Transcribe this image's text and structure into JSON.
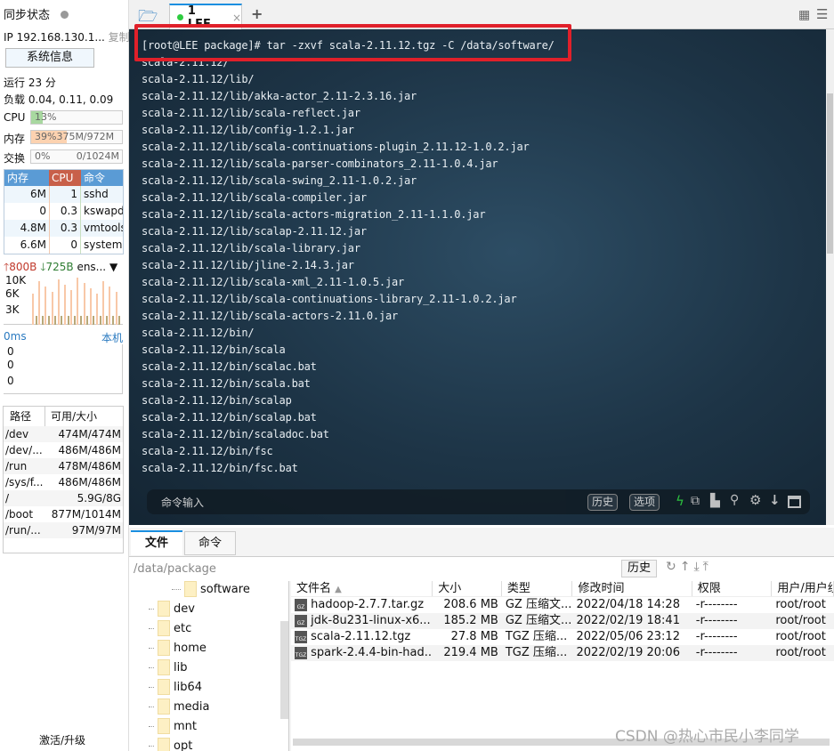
{
  "sidebar": {
    "sync_status": "同步状态",
    "ip": "IP 192.168.130.1...",
    "copy": "复制",
    "sysinfo": "系统信息",
    "uptime": "运行 23 分",
    "load": "负载 0.04, 0.11, 0.09",
    "cpu_label": "CPU",
    "cpu_value": "13%",
    "cpu_percent": 13,
    "mem_label": "内存",
    "mem_value": "39%375M/972M",
    "mem_percent": 39,
    "swap_label": "交换",
    "swap_pct": "0%",
    "swap_value": "0/1024M",
    "swap_percent": 0,
    "proc_headers": [
      "内存",
      "CPU",
      "命令"
    ],
    "procs": [
      [
        "6M",
        "1",
        "sshd"
      ],
      [
        "0",
        "0.3",
        "kswapd0"
      ],
      [
        "4.8M",
        "0.3",
        "vmtools"
      ],
      [
        "6.6M",
        "0",
        "systemd"
      ]
    ],
    "net_up": "800B",
    "net_down": "725B",
    "net_iface": "ens...",
    "net_ticks": [
      "10K",
      "6K",
      "3K"
    ],
    "ping": "0ms",
    "ping_host": "本机",
    "ping_ticks": [
      "0",
      "0",
      "0"
    ],
    "disk_headers": [
      "路径",
      "可用/大小"
    ],
    "disks": [
      [
        "/dev",
        "474M/474M"
      ],
      [
        "/dev/...",
        "486M/486M"
      ],
      [
        "/run",
        "478M/486M"
      ],
      [
        "/sys/f...",
        "486M/486M"
      ],
      [
        "/",
        "5.9G/8G"
      ],
      [
        "/boot",
        "877M/1014M"
      ],
      [
        "/run/...",
        "97M/97M"
      ]
    ],
    "activate": "激活/升级"
  },
  "tabs": {
    "session": "1 LEE",
    "accent": "#1a8fe0"
  },
  "terminal": {
    "command": "[root@LEE package]# tar -zxvf scala-2.11.12.tgz -C /data/software/",
    "lines": [
      "scala-2.11.12/",
      "scala-2.11.12/lib/",
      "scala-2.11.12/lib/akka-actor_2.11-2.3.16.jar",
      "scala-2.11.12/lib/scala-reflect.jar",
      "scala-2.11.12/lib/config-1.2.1.jar",
      "scala-2.11.12/lib/scala-continuations-plugin_2.11.12-1.0.2.jar",
      "scala-2.11.12/lib/scala-parser-combinators_2.11-1.0.4.jar",
      "scala-2.11.12/lib/scala-swing_2.11-1.0.2.jar",
      "scala-2.11.12/lib/scala-compiler.jar",
      "scala-2.11.12/lib/scala-actors-migration_2.11-1.1.0.jar",
      "scala-2.11.12/lib/scalap-2.11.12.jar",
      "scala-2.11.12/lib/scala-library.jar",
      "scala-2.11.12/lib/jline-2.14.3.jar",
      "scala-2.11.12/lib/scala-xml_2.11-1.0.5.jar",
      "scala-2.11.12/lib/scala-continuations-library_2.11-1.0.2.jar",
      "scala-2.11.12/lib/scala-actors-2.11.0.jar",
      "scala-2.11.12/bin/",
      "scala-2.11.12/bin/scala",
      "scala-2.11.12/bin/scalac.bat",
      "scala-2.11.12/bin/scala.bat",
      "scala-2.11.12/bin/scalap",
      "scala-2.11.12/bin/scalap.bat",
      "scala-2.11.12/bin/scaladoc.bat",
      "scala-2.11.12/bin/fsc",
      "scala-2.11.12/bin/fsc.bat"
    ],
    "cmd_input": "命令输入",
    "history": "历史",
    "options": "选项"
  },
  "files": {
    "tab_files": "文件",
    "tab_cmds": "命令",
    "path": "/data/package",
    "history": "历史",
    "tree": [
      "software",
      "dev",
      "etc",
      "home",
      "lib",
      "lib64",
      "media",
      "mnt",
      "opt"
    ],
    "headers": [
      "文件名",
      "大小",
      "类型",
      "修改时间",
      "权限",
      "用户/用户组"
    ],
    "rows": [
      [
        "GZ",
        "hadoop-2.7.7.tar.gz",
        "208.6 MB",
        "GZ 压缩文...",
        "2022/04/18 14:28",
        "-r--------",
        "root/root"
      ],
      [
        "GZ",
        "jdk-8u231-linux-x6...",
        "185.2 MB",
        "GZ 压缩文...",
        "2022/02/19 18:41",
        "-r--------",
        "root/root"
      ],
      [
        "TGZ",
        "scala-2.11.12.tgz",
        "27.8 MB",
        "TGZ 压缩...",
        "2022/05/06 23:12",
        "-r--------",
        "root/root"
      ],
      [
        "TGZ",
        "spark-2.4.4-bin-had...",
        "219.4 MB",
        "TGZ 压缩...",
        "2022/02/19 20:06",
        "-r--------",
        "root/root"
      ]
    ]
  },
  "watermark": "CSDN @热心市民小李同学"
}
